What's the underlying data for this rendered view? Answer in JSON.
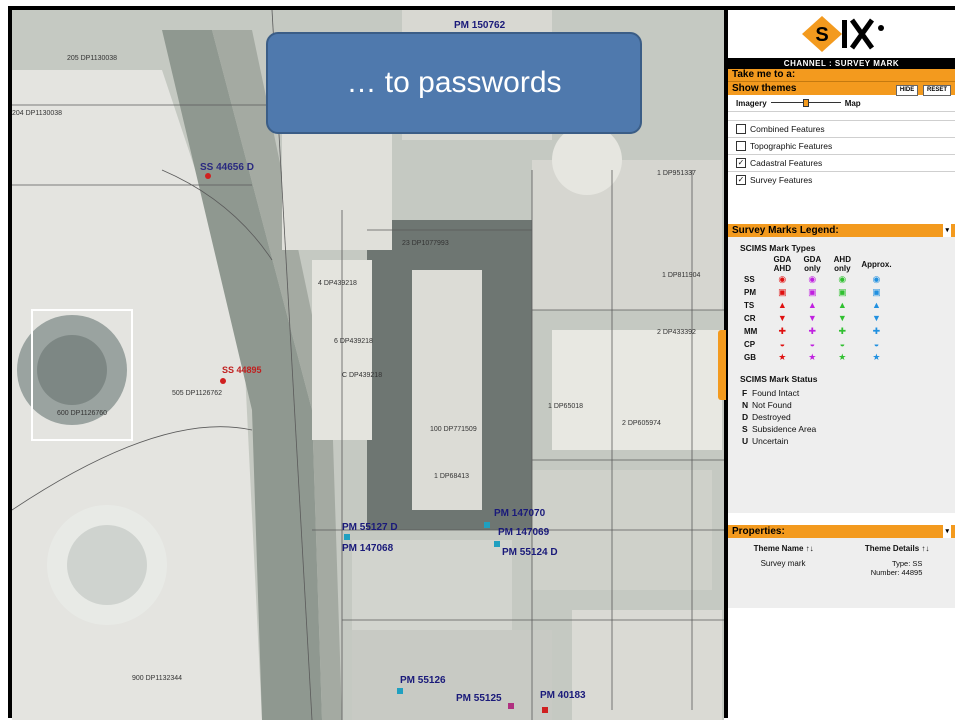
{
  "callout": {
    "text": "… to passwords"
  },
  "panel": {
    "logo_text": "SIX",
    "channel_label": "CHANNEL : SURVEY MARK",
    "take_me_to": "Take me to a:",
    "show_themes": "Show themes",
    "hide_button": "HIDE",
    "reset_button": "RESET",
    "imagery_label": "Imagery",
    "map_label": "Map",
    "themes": [
      {
        "label": "Combined Features",
        "checked": false
      },
      {
        "label": "Topographic Features",
        "checked": false
      },
      {
        "label": "Cadastral Features",
        "checked": true
      },
      {
        "label": "Survey Features",
        "checked": true
      }
    ],
    "legend_header": "Survey Marks Legend:",
    "mark_types_title": "SCIMS Mark Types",
    "column_headers": [
      "GDA AHD",
      "GDA only",
      "AHD only",
      "Approx."
    ],
    "mark_types": [
      {
        "code": "SS",
        "glyph": "◉"
      },
      {
        "code": "PM",
        "glyph": "▣"
      },
      {
        "code": "TS",
        "glyph": "▲"
      },
      {
        "code": "CR",
        "glyph": "▼"
      },
      {
        "code": "MM",
        "glyph": "✚"
      },
      {
        "code": "CP",
        "glyph": "◒"
      },
      {
        "code": "GB",
        "glyph": "★"
      }
    ],
    "type_colors": [
      "#e01010",
      "#c020e0",
      "#30c030",
      "#2090e0"
    ],
    "mark_status_title": "SCIMS Mark Status",
    "mark_status": [
      {
        "code": "F",
        "label": "Found Intact"
      },
      {
        "code": "N",
        "label": "Not Found"
      },
      {
        "code": "D",
        "label": "Destroyed"
      },
      {
        "code": "S",
        "label": "Subsidence Area"
      },
      {
        "code": "U",
        "label": "Uncertain"
      }
    ],
    "properties_header": "Properties:",
    "prop_name_header": "Theme Name ↑↓",
    "prop_details_header": "Theme Details ↑↓",
    "prop_name_value": "Survey mark",
    "prop_type_value": "Type: SS",
    "prop_number_value": "Number: 44895"
  },
  "map_labels": {
    "pm_150762": "PM 150762",
    "ss_44656": "SS 44656 D",
    "ss_44895": "SS 44895",
    "pm_55127": "PM 55127 D",
    "pm_147068": "PM 147068",
    "pm_147070": "PM 147070",
    "pm_147069": "PM 147069",
    "pm_55124": "PM 55124 D",
    "pm_55126": "PM 55126",
    "pm_55125": "PM 55125",
    "pm_40183": "PM 40183",
    "dp_1": "205 DP1130038",
    "dp_2": "204 DP1130038",
    "dp_3": "600 DP1126760",
    "dp_4": "900 DP1132344",
    "dp_5": "1 DP811904",
    "dp_6": "2 DP433392",
    "dp_7": "2 DP605974",
    "dp_8": "1 DP65018",
    "dp_9": "100 DP771509",
    "dp_10": "23 DP1077993",
    "dp_11": "1 DP68413",
    "dp_12": "6 DP439218",
    "dp_13": "4 DP439218",
    "dp_14": "1 DP951337",
    "dp_15": "C DP439218",
    "dp_16": "505 DP1126762"
  }
}
